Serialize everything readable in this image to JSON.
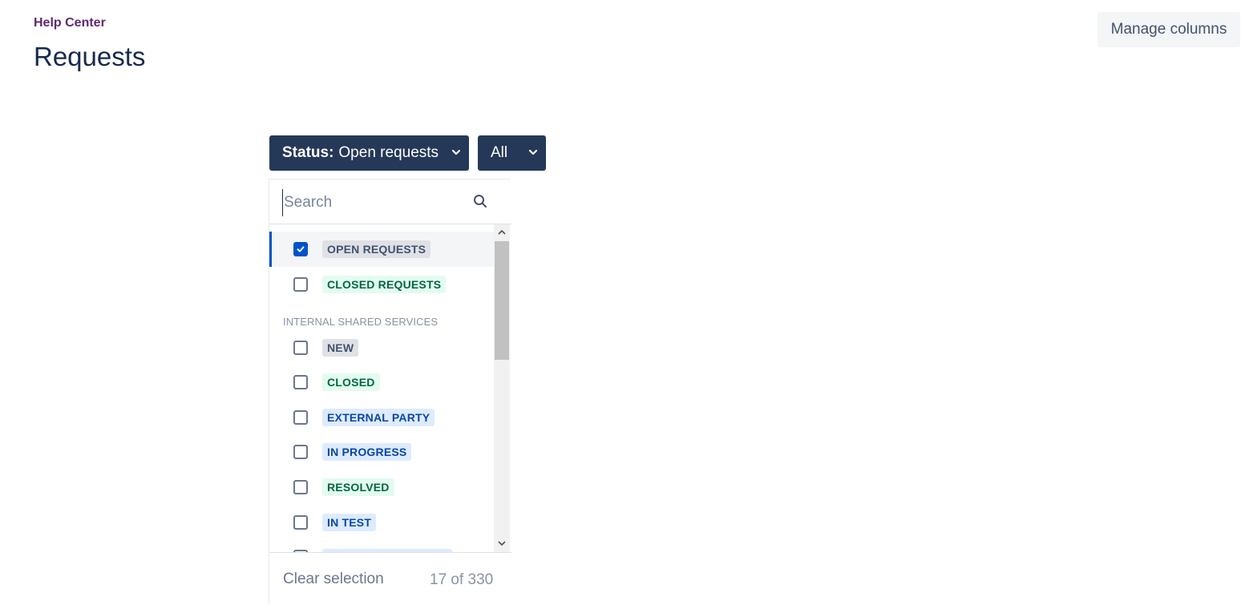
{
  "header": {
    "breadcrumb": "Help Center",
    "title": "Requests",
    "manage_columns_label": "Manage columns"
  },
  "filters": {
    "status": {
      "key": "Status:",
      "value": "Open requests"
    },
    "scope": {
      "value": "All"
    }
  },
  "dropdown": {
    "search": {
      "placeholder": "Search",
      "value": ""
    },
    "top_items": [
      {
        "label": "OPEN REQUESTS",
        "checked": true,
        "color": "grey"
      },
      {
        "label": "CLOSED REQUESTS",
        "checked": false,
        "color": "green"
      }
    ],
    "group_heading": "INTERNAL SHARED SERVICES",
    "group_items": [
      {
        "label": "NEW",
        "checked": false,
        "color": "grey"
      },
      {
        "label": "CLOSED",
        "checked": false,
        "color": "green"
      },
      {
        "label": "EXTERNAL PARTY",
        "checked": false,
        "color": "blue"
      },
      {
        "label": "IN PROGRESS",
        "checked": false,
        "color": "blue"
      },
      {
        "label": "RESOLVED",
        "checked": false,
        "color": "green"
      },
      {
        "label": "IN TEST",
        "checked": false,
        "color": "blue"
      }
    ],
    "footer": {
      "clear_label": "Clear selection",
      "count": "17 of 330"
    }
  },
  "colors": {
    "primary_button": "#253858",
    "checkbox_checked": "#0052cc",
    "lozenge_grey": "#dfe1e6",
    "lozenge_green": "#e3fcef",
    "lozenge_blue": "#deebff"
  },
  "icons": [
    "chevron-down-icon",
    "search-icon",
    "check-icon",
    "scroll-up-icon",
    "scroll-down-icon"
  ]
}
